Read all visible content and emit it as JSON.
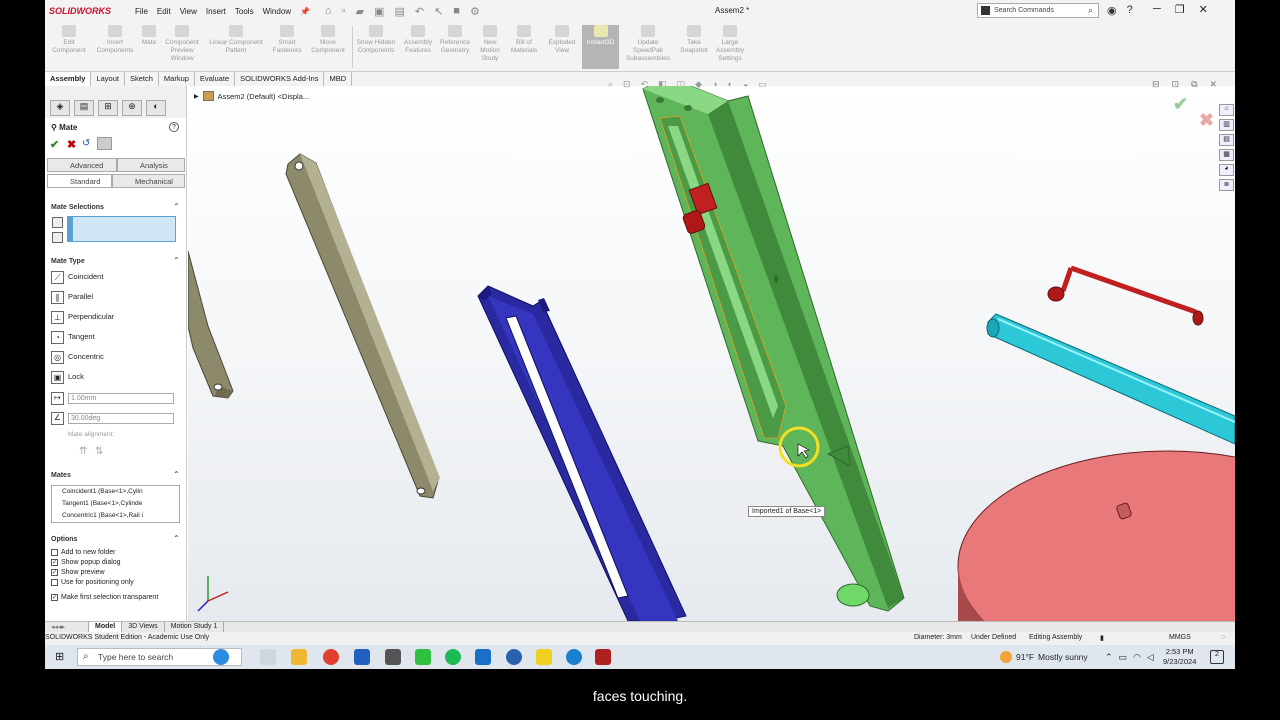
{
  "app": {
    "logo": "SOLIDWORKS",
    "document_title": "Assem2 *"
  },
  "menu": [
    "File",
    "Edit",
    "View",
    "Insert",
    "Tools",
    "Window"
  ],
  "search": {
    "placeholder": "Search Commands"
  },
  "command_manager": [
    {
      "label": "Edit Component"
    },
    {
      "label": "Insert Components"
    },
    {
      "label": "Mate"
    },
    {
      "label": "Component Preview Window"
    },
    {
      "label": "Linear Component Pattern"
    },
    {
      "label": "Smart Fasteners"
    },
    {
      "label": "Move Component"
    },
    {
      "label": "Show Hidden Components"
    },
    {
      "label": "Assembly Features"
    },
    {
      "label": "Reference Geometry"
    },
    {
      "label": "New Motion Study"
    },
    {
      "label": "Bill of Materials"
    },
    {
      "label": "Exploded View"
    },
    {
      "label": "Instant3D"
    },
    {
      "label": "Update SpeedPak Subassemblies"
    },
    {
      "label": "Take Snapshot"
    },
    {
      "label": "Large Assembly Settings"
    }
  ],
  "tabs": [
    "Assembly",
    "Layout",
    "Sketch",
    "Markup",
    "Evaluate",
    "SOLIDWORKS Add-Ins",
    "MBD"
  ],
  "property_manager": {
    "title": "Mate",
    "subtabs": {
      "advanced": "Advanced",
      "analysis": "Analysis",
      "standard": "Standard",
      "mechanical": "Mechanical"
    },
    "mate_selections_header": "Mate Selections",
    "mate_type_header": "Mate Type",
    "mate_types": [
      "Coincident",
      "Parallel",
      "Perpendicular",
      "Tangent",
      "Concentric",
      "Lock"
    ],
    "distance_value": "1.00mm",
    "angle_value": "30.00deg",
    "mate_alignment_label": "Mate alignment:",
    "mates_header": "Mates",
    "mates": [
      "Coincident1 (Base<1>,Cylin",
      "Tangent1 (Base<1>,Cylinde",
      "Concentric1 (Base<1>,Rail i"
    ],
    "options_header": "Options",
    "options": [
      {
        "label": "Add to new folder",
        "checked": false
      },
      {
        "label": "Show popup dialog",
        "checked": true
      },
      {
        "label": "Show preview",
        "checked": true
      },
      {
        "label": "Use for positioning only",
        "checked": false
      },
      {
        "label": "Make first selection transparent",
        "checked": true
      }
    ]
  },
  "viewport": {
    "tree_item": "Assem2 (Default) <Displa...",
    "tooltip": "Imported1 of Base<1>"
  },
  "model_tabs": [
    "Model",
    "3D Views",
    "Motion Study 1"
  ],
  "status_bar": {
    "left": "SOLIDWORKS Student Edition - Academic Use Only",
    "diameter": "Diameter: 3mm",
    "state": "Under Defined",
    "mode": "Editing Assembly",
    "units": "MMGS"
  },
  "taskbar": {
    "search_placeholder": "Type here to search",
    "weather_temp": "91°F",
    "weather_desc": "Mostly sunny",
    "time": "2:53 PM",
    "date": "9/23/2024",
    "notification_count": "2"
  },
  "caption": "faces touching."
}
